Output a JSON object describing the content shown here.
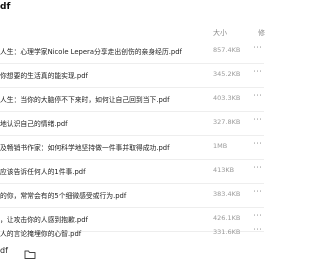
{
  "window": {
    "title": "df"
  },
  "columns": {
    "size": "大小",
    "more": "修"
  },
  "files": [
    {
      "name": "人生：心理学家Nicole Lepera分享走出创伤的亲身经历.pdf",
      "size": "857.4KB"
    },
    {
      "name": "你想要的生活真的能实现.pdf",
      "size": "345.2KB"
    },
    {
      "name": "人生：当你的大脑停不下来时，如何让自己回到当下.pdf",
      "size": "403.3KB"
    },
    {
      "name": "地认识自己的情绪.pdf",
      "size": "327.8KB"
    },
    {
      "name": "及畅销书作家：如何科学地坚持做一件事并取得成功.pdf",
      "size": "1MB"
    },
    {
      "name": "应该告诉任何人的1件事.pdf",
      "size": "413KB"
    },
    {
      "name": "的你，常常会有的5个细微感受或行为.pdf",
      "size": "383.4KB"
    },
    {
      "name": "，让攻击你的人感到抱歉.pdf",
      "size": "426.1KB"
    },
    {
      "name": "人的言论掩埋你的心智.pdf",
      "size": "331.6KB"
    }
  ],
  "toolbar": {
    "label": "df"
  },
  "icons": {
    "row_menu": "more-dots-icon",
    "folder": "folder-icon"
  }
}
